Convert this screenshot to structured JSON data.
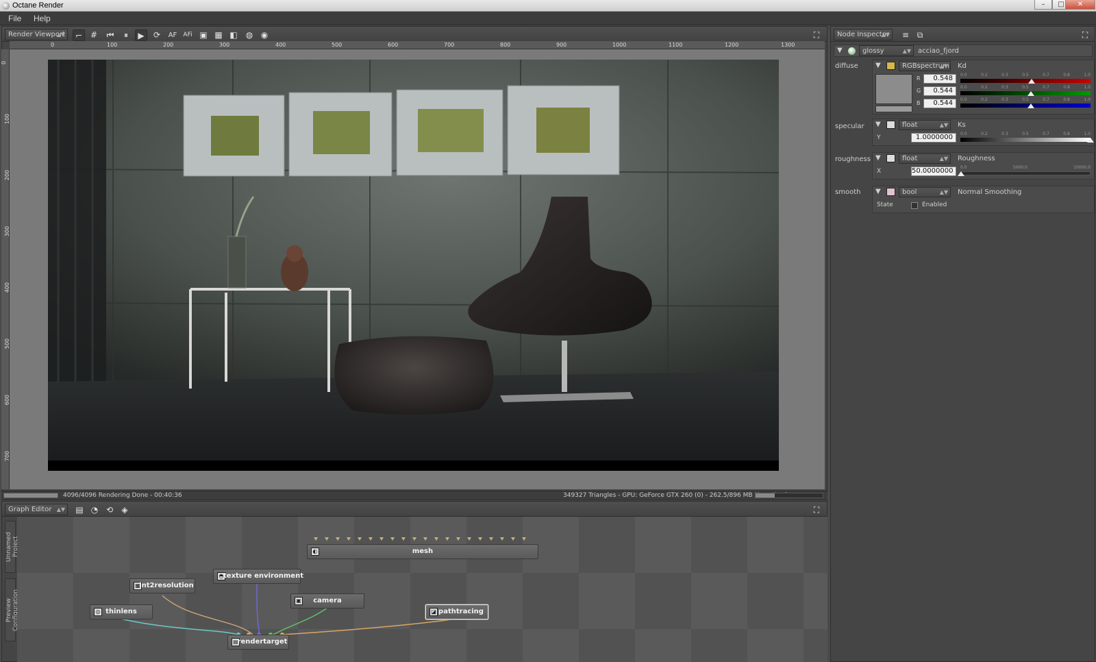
{
  "window": {
    "title": "Octane Render",
    "controls": {
      "minimize": "–",
      "maximize": "□",
      "close": "✕"
    }
  },
  "menu": [
    "File",
    "Help"
  ],
  "viewport": {
    "selector": "Render Viewport",
    "toolbar_labels": {
      "af": "AF",
      "afi": "AFi"
    },
    "ruler_top": [
      "0",
      "100",
      "200",
      "300",
      "400",
      "500",
      "600",
      "700",
      "800",
      "900",
      "1000",
      "1100",
      "1200",
      "1300"
    ],
    "ruler_left": [
      "0",
      "100",
      "200",
      "300",
      "400",
      "500",
      "600",
      "700"
    ],
    "status_left": "4096/4096 Rendering Done - 00:40:36",
    "status_right": "349327 Triangles - GPU: GeForce GTX 260 (0) - 262.5/896 MB Mem Used",
    "progress": 1.0,
    "mem_fraction": 0.29
  },
  "inspector": {
    "title": "Node Inspector",
    "node_type": "glossy",
    "node_name": "acciao_fjord",
    "diffuse": {
      "label": "diffuse",
      "type": "RGBspectrum",
      "name": "Kd",
      "swatch_color": "#8c8c8c",
      "scale": [
        "0.0",
        "0.2",
        "0.3",
        "0.5",
        "0.7",
        "0.8",
        "1.0"
      ],
      "channels": [
        {
          "name": "R",
          "value": "0.548",
          "fraction": 0.548,
          "color": "#cc0000"
        },
        {
          "name": "G",
          "value": "0.544",
          "fraction": 0.544,
          "color": "#009900"
        },
        {
          "name": "B",
          "value": "0.544",
          "fraction": 0.544,
          "color": "#0000cc"
        }
      ]
    },
    "specular": {
      "label": "specular",
      "type": "float",
      "name": "Ks",
      "axis": "Y",
      "value": "1.0000000",
      "fraction": 1.0,
      "scale": [
        "0.0",
        "0.2",
        "0.3",
        "0.5",
        "0.7",
        "0.8",
        "1.0"
      ]
    },
    "roughness": {
      "label": "roughness",
      "type": "float",
      "name": "Roughness",
      "axis": "X",
      "value": "50.0000000",
      "fraction": 0.005,
      "scale_min": "0.0",
      "scale_mid": "5000.0",
      "scale_max": "10000.0"
    },
    "smooth": {
      "label": "smooth",
      "type": "bool",
      "name": "Normal Smoothing",
      "state_label": "State",
      "check_label": "Enabled",
      "checked": false
    }
  },
  "graph": {
    "title": "Graph Editor",
    "side_tabs": [
      "Unnamed Project",
      "Preview Configuration"
    ],
    "nodes": {
      "mesh": "mesh",
      "texture_environment": "texture environment",
      "int2resolution": "int2resolution",
      "camera": "camera",
      "thinlens": "thinlens",
      "pathtracing": "pathtracing",
      "rendertarget": "rendertarget"
    },
    "link_colors": {
      "int2resolution": "#c9a27a",
      "texture_environment": "#6d68d8",
      "camera": "#62c06a",
      "thinlens": "#6cc9c9",
      "pathtracing": "#d9a865"
    }
  }
}
